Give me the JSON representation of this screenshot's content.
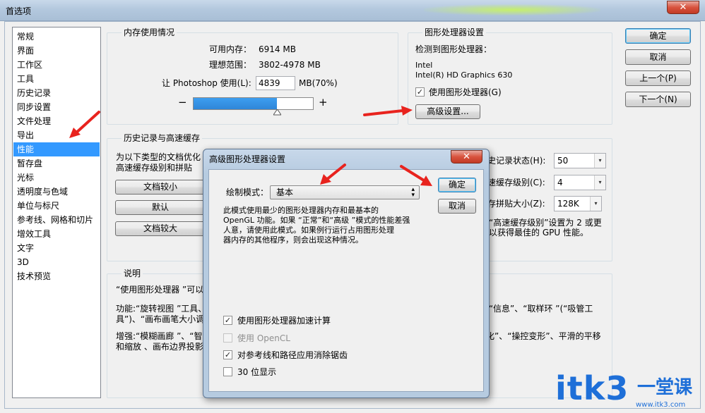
{
  "window": {
    "title": "首选项",
    "close_glyph": "✕"
  },
  "nav": {
    "items": [
      "常规",
      "界面",
      "工作区",
      "工具",
      "历史记录",
      "同步设置",
      "文件处理",
      "导出",
      "性能",
      "暂存盘",
      "光标",
      "透明度与色域",
      "单位与标尺",
      "参考线、网格和切片",
      "增效工具",
      "文字",
      "3D",
      "技术预览"
    ],
    "selected": "性能"
  },
  "memory": {
    "title": "内存使用情况",
    "available_label": "可用内存：",
    "available_value": "6914 MB",
    "ideal_label": "理想范围：",
    "ideal_value": "3802-4978 MB",
    "let_label": "让 Photoshop 使用(L):",
    "use_value": "4839",
    "use_suffix": "MB(70%)",
    "minus": "−",
    "plus": "+",
    "slider_fraction": 0.7
  },
  "gpu": {
    "title": "图形处理器设置",
    "detected_label": "检测到图形处理器：",
    "vendor": "Intel",
    "model": "Intel(R) HD Graphics 630",
    "use_gpu_label": "使用图形处理器(G)",
    "use_gpu_checked": true,
    "advanced_button": "高级设置..."
  },
  "history": {
    "title": "历史记录与高速缓存",
    "desc_line1": "为以下类型的文档优化",
    "desc_line2": "高速缓存级别和拼贴",
    "btn_small": "文档较小",
    "btn_default": "默认",
    "btn_large": "文档较大",
    "states_label": "史记录状态(H):",
    "states_value": "50",
    "cache_levels_label": "速缓存级别(C):",
    "cache_levels_value": "4",
    "tile_size_label": "存拼贴大小(Z):",
    "tile_size_value": "128K",
    "note_line1": "“高速缓存级别”设置为 2 或更",
    "note_line2": "以获得最佳的 GPU 性能。"
  },
  "description": {
    "title": "说明",
    "line1": "“使用图形处理器 ”可以",
    "line2_left": "功能:“旋转视图 ”工具、",
    "line2_right": "光标 “信息”、“取样环 ”(“吸管工",
    "line3_left": "具”)、“画布画笔大小调",
    "line4_left": "增强:“模糊画廊 ”、“智能",
    "line4_right": "化”、“操控变形”、平滑的平移",
    "line5_left": "和缩放 、画布边界投影"
  },
  "side_buttons": {
    "ok": "确定",
    "cancel": "取消",
    "prev": "上一个(P)",
    "next": "下一个(N)"
  },
  "advanced_dialog": {
    "title": "高级图形处理器设置",
    "close_glyph": "✕",
    "draw_mode_label": "绘制模式：",
    "draw_mode_value": "基本",
    "ok": "确定",
    "cancel": "取消",
    "desc_lines": [
      "此模式使用最少的图形处理器内存和最基本的",
      "OpenGL 功能。如果 “正常”和“高级 ”模式的性能差强",
      "人意，请使用此模式。如果例行运行占用图形处理",
      "器内存的其他程序，则会出现这种情况。"
    ],
    "options": [
      {
        "label": "使用图形处理器加速计算",
        "checked": true,
        "disabled": false
      },
      {
        "label": "使用 OpenCL",
        "checked": false,
        "disabled": true
      },
      {
        "label": "对参考线和路径应用消除锯齿",
        "checked": true,
        "disabled": false
      },
      {
        "label": "30 位显示",
        "checked": false,
        "disabled": false
      }
    ]
  },
  "watermark": {
    "latin": "itk3",
    "cjk": "一堂课",
    "url": "www.itk3.com"
  },
  "colors": {
    "selection": "#3399ff",
    "arrow": "#e8231e",
    "watermark_blue": "#1e6fd8"
  }
}
